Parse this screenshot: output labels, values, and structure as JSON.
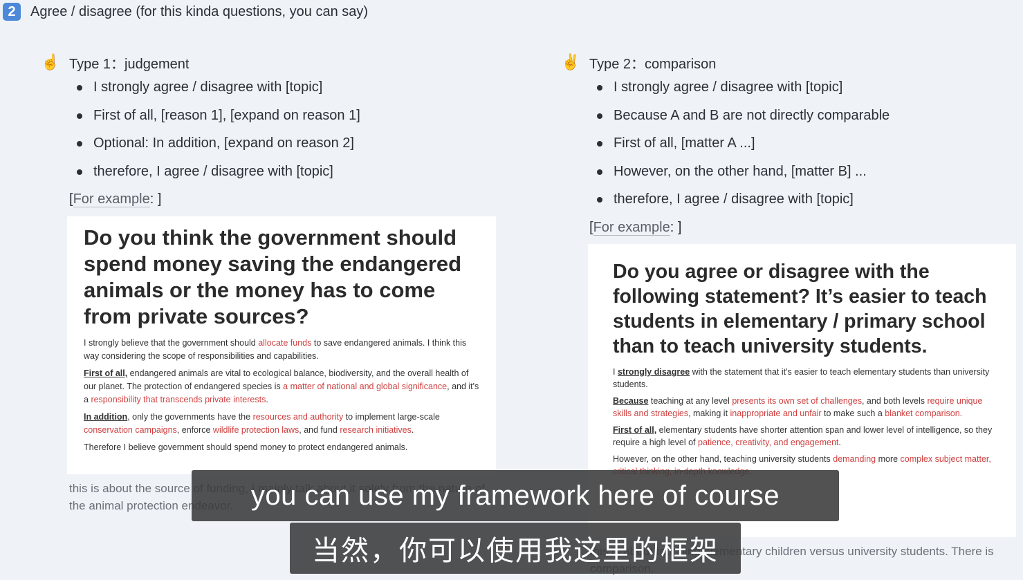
{
  "heading": {
    "badge": "2",
    "text": "Agree / disagree (for this kinda questions, you can say)"
  },
  "left": {
    "hand_icon": "☝",
    "type_title": "Type 1：judgement",
    "points": [
      "I strongly agree / disagree with [topic]",
      "First of all, [reason 1], [expand on reason 1]",
      "Optional: In addition, [expand on reason 2]",
      "therefore, I agree / disagree with [topic]"
    ],
    "example_open": "[",
    "example_link": "For example",
    "example_close": ": ]",
    "card": {
      "question": "Do you think the government should spend money saving the endangered animals or the money has to come from private sources?",
      "p1_a": "I strongly believe that the government should ",
      "p1_h1": "allocate funds",
      "p1_b": " to save endangered animals. I think this way considering the scope of responsibilities and capabilities.",
      "p2_u": "First of all,",
      "p2_a": " endangered animals are vital to ecological balance, biodiversity, and the overall health of our planet. The protection of endangered species is ",
      "p2_h1": "a matter of national and global significance",
      "p2_b": ", and it's a ",
      "p2_h2": "responsibility that transcends private interests",
      "p2_c": ".",
      "p3_u": "In addition",
      "p3_a": ", only the governments have the ",
      "p3_h1": "resources and authority",
      "p3_b": " to implement large-scale ",
      "p3_h2": "conservation campaigns",
      "p3_c": ", enforce ",
      "p3_h3": "wildlife protection laws",
      "p3_d": ", and fund ",
      "p3_h4": "research initiatives",
      "p3_e": ".",
      "p4": "Therefore I believe government should spend money to protect endangered animals."
    },
    "note": "this is about the source of funding, I mainly talk about it solely from the nature of the animal protection endeavor."
  },
  "right": {
    "hand_icon": "✌",
    "type_title": "Type 2：comparison",
    "points": [
      "I strongly agree / disagree with [topic]",
      "Because A and B are not directly comparable",
      "First of all, [matter A ...]",
      "However, on the other hand, [matter B] ...",
      "therefore, I agree / disagree with [topic]"
    ],
    "example_open": "[",
    "example_link": "For example",
    "example_close": ": ]",
    "card": {
      "question": "Do you agree or disagree with the following statement? It’s easier to teach students  in elementary / primary school than to teach university students.",
      "p1_a": "I ",
      "p1_u": "strongly disagree",
      "p1_b": " with the statement that it's easier to teach elementary students than university students.",
      "p2_u": "Because",
      "p2_a": " teaching at any level ",
      "p2_h1": "presents its own set of challenges",
      "p2_b": ", and both levels ",
      "p2_h2": "require unique skills and strategies",
      "p2_c": ", making it ",
      "p2_h3": "inappropriate and unfair",
      "p2_d": " to make such a ",
      "p2_h4": "blanket comparison.",
      "p3_u": "First of all,",
      "p3_a": " elementary students have shorter attention span and lower level of intelligence, so they require a high level of ",
      "p3_h1": "patience, creativity, and engagement",
      "p3_b": ".",
      "p4_a": "However, on the other hand, teaching university students ",
      "p4_h1": "demanding",
      "p4_b": " more ",
      "p4_h2": "complex subject matter, critical thinking,  in-depth knowledge.",
      "p4_c": ""
    },
    "note": "this is about teaching elementary children versus university students. There is comparison."
  },
  "subtitles": {
    "english": "you can use my framework here of course",
    "chinese": "当然，你可以使用我这里的框架"
  }
}
